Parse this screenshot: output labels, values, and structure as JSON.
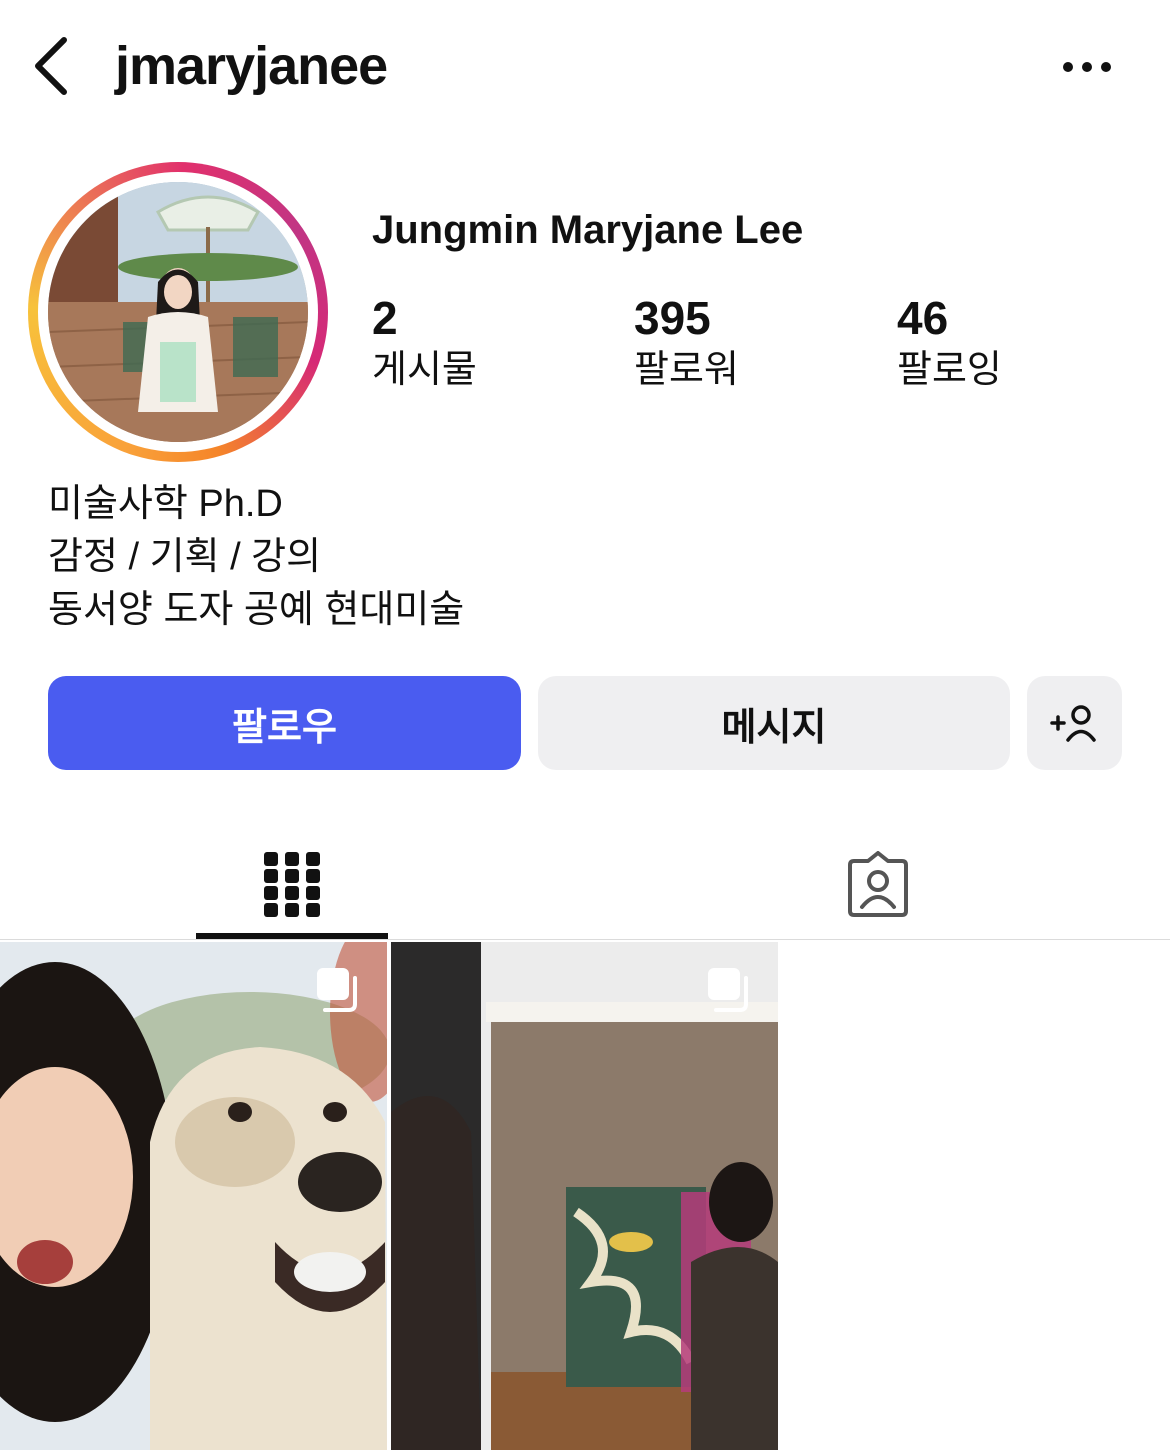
{
  "header": {
    "username": "jmaryjanee",
    "back_icon": "chevron-left-icon",
    "more_icon": "more-horizontal-icon"
  },
  "profile": {
    "full_name": "Jungmin Maryjane Lee",
    "stats": [
      {
        "value": "2",
        "label": "게시물"
      },
      {
        "value": "395",
        "label": "팔로워"
      },
      {
        "value": "46",
        "label": "팔로잉"
      }
    ],
    "bio": [
      "미술사학 Ph.D",
      "감정 / 기획 / 강의",
      "동서양 도자 공예 현대미술"
    ]
  },
  "actions": {
    "follow_label": "팔로우",
    "message_label": "메시지",
    "add_user_icon": "add-user-icon"
  },
  "tabs": [
    {
      "icon": "grid-icon",
      "active": true
    },
    {
      "icon": "tagged-person-icon",
      "active": false
    }
  ],
  "colors": {
    "follow_button": "#4a5cf0",
    "secondary_button": "#efeff1",
    "story_ring": [
      "#f9a13a",
      "#e1306c",
      "#c13584"
    ]
  },
  "posts": [
    {
      "type": "carousel"
    },
    {
      "type": "carousel"
    }
  ]
}
